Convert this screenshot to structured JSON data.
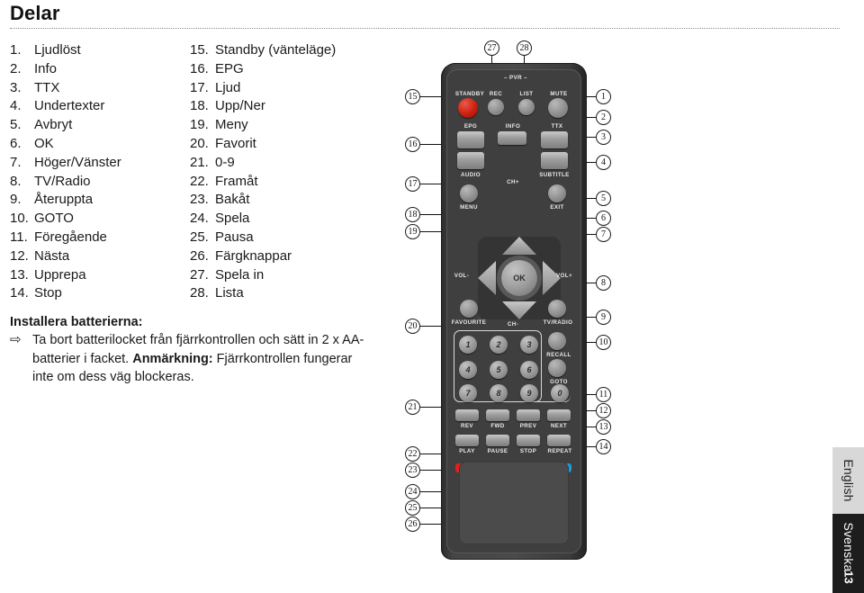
{
  "header": {
    "title": "Delar"
  },
  "parts_list": {
    "column_left": [
      {
        "num": "1.",
        "label": "Ljudlöst"
      },
      {
        "num": "2.",
        "label": "Info"
      },
      {
        "num": "3.",
        "label": "TTX"
      },
      {
        "num": "4.",
        "label": "Undertexter"
      },
      {
        "num": "5.",
        "label": "Avbryt"
      },
      {
        "num": "6.",
        "label": "OK"
      },
      {
        "num": "7.",
        "label": "Höger/Vänster"
      },
      {
        "num": "8.",
        "label": "TV/Radio"
      },
      {
        "num": "9.",
        "label": "Återuppta"
      },
      {
        "num": "10.",
        "label": "GOTO"
      },
      {
        "num": "11.",
        "label": "Föregående"
      },
      {
        "num": "12.",
        "label": "Nästa"
      },
      {
        "num": "13.",
        "label": "Upprepa"
      },
      {
        "num": "14.",
        "label": "Stop"
      }
    ],
    "column_right": [
      {
        "num": "15.",
        "label": "Standby (vänteläge)"
      },
      {
        "num": "16.",
        "label": "EPG"
      },
      {
        "num": "17.",
        "label": "Ljud"
      },
      {
        "num": "18.",
        "label": "Upp/Ner"
      },
      {
        "num": "19.",
        "label": "Meny"
      },
      {
        "num": "20.",
        "label": "Favorit"
      },
      {
        "num": "21.",
        "label": "0-9"
      },
      {
        "num": "22.",
        "label": "Framåt"
      },
      {
        "num": "23.",
        "label": "Bakåt"
      },
      {
        "num": "24.",
        "label": "Spela"
      },
      {
        "num": "25.",
        "label": "Pausa"
      },
      {
        "num": "26.",
        "label": "Färgknappar"
      },
      {
        "num": "27.",
        "label": "Spela in"
      },
      {
        "num": "28.",
        "label": "Lista"
      }
    ]
  },
  "battery_note": {
    "title": "Installera batterierna:",
    "arrow": "⇨",
    "instruction": "Ta bort batterilocket från fjärrkontrollen och sätt in 2 x AA-batterier i facket.",
    "remark_label": "Anmärkning:",
    "remark_text": "Fjärrkontrollen fungerar inte om dess väg blockeras."
  },
  "remote": {
    "section_label_pvr": "– PVR –",
    "buttons": {
      "standby": "STANDBY",
      "rec": "REC",
      "list": "LIST",
      "mute": "MUTE",
      "epg": "EPG",
      "info": "INFO",
      "ttx": "TTX",
      "audio": "AUDIO",
      "subtitle": "SUBTITLE",
      "menu": "MENU",
      "exit": "EXIT",
      "ch_up": "CH+",
      "ch_down": "CH-",
      "vol_down": "VOL-",
      "vol_up": "VOL+",
      "ok": "OK",
      "favourite": "FAVOURITE",
      "tvradio": "TV/RADIO",
      "recall": "RECALL",
      "goto": "GOTO",
      "rev": "REV",
      "fwd": "FWD",
      "prev": "PREV",
      "next": "NEXT",
      "play": "PLAY",
      "pause": "PAUSE",
      "stop": "STOP",
      "repeat": "REPEAT"
    },
    "keypad": [
      "1",
      "2",
      "3",
      "4",
      "5",
      "6",
      "7",
      "8",
      "9",
      "0"
    ],
    "color_buttons": [
      {
        "name": "red",
        "hex": "#e02020"
      },
      {
        "name": "green",
        "hex": "#16a34a"
      },
      {
        "name": "yellow",
        "hex": "#f2e313"
      },
      {
        "name": "blue",
        "hex": "#1a9ae0"
      }
    ],
    "callouts_right": [
      "1",
      "2",
      "3",
      "4",
      "5",
      "6",
      "7",
      "8",
      "9",
      "10",
      "11",
      "12",
      "13",
      "14"
    ],
    "callouts_left": [
      "15",
      "16",
      "17",
      "18",
      "19",
      "20",
      "21",
      "22",
      "23",
      "24",
      "25",
      "26"
    ],
    "callouts_top": [
      "27",
      "28"
    ]
  },
  "side_tabs": {
    "english": "English",
    "svenska": "Svenska",
    "page_number": "13"
  }
}
